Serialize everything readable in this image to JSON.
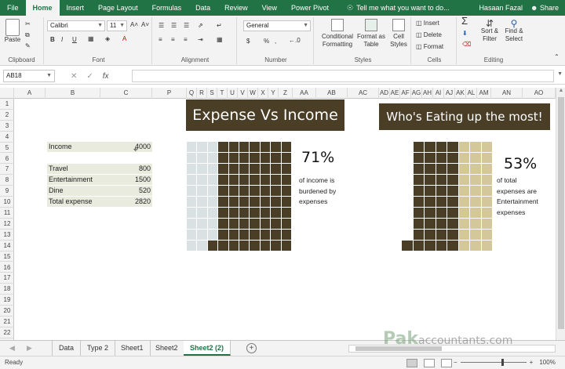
{
  "ribbon_tabs": [
    "File",
    "Home",
    "Insert",
    "Page Layout",
    "Formulas",
    "Data",
    "Review",
    "View",
    "Power Pivot"
  ],
  "active_tab": "Home",
  "tell_me": "Tell me what you want to do...",
  "user": "Hasaan Fazal",
  "share": "Share",
  "clipboard": {
    "paste": "Paste",
    "label": "Clipboard"
  },
  "font": {
    "name": "Calibri",
    "size": "11",
    "bold": "B",
    "italic": "I",
    "underline": "U",
    "label": "Font"
  },
  "alignment": {
    "label": "Alignment"
  },
  "number": {
    "format": "General",
    "currency": "$",
    "percent": "%",
    "comma": ",",
    "label": "Number"
  },
  "styles": {
    "conditional": "Conditional",
    "conditional2": "Formatting",
    "format_as": "Format as",
    "format_as2": "Table",
    "cell_styles": "Cell",
    "cell_styles2": "Styles",
    "label": "Styles"
  },
  "cells": {
    "insert": "Insert",
    "delete": "Delete",
    "format": "Format",
    "label": "Cells"
  },
  "editing": {
    "sum": "Σ",
    "sort": "Sort &",
    "sort2": "Filter",
    "find": "Find &",
    "find2": "Select",
    "label": "Editing"
  },
  "name_box": "AB18",
  "fx": "fx",
  "columns": [
    "A",
    "B",
    "C",
    "P",
    "Q",
    "R",
    "S",
    "T",
    "U",
    "V",
    "W",
    "X",
    "Y",
    "Z",
    "AA",
    "AB",
    "AC",
    "AD",
    "AE",
    "AF",
    "AG",
    "AH",
    "AI",
    "AJ",
    "AK",
    "AL",
    "AM",
    "AN",
    "AO"
  ],
  "rows": [
    "1",
    "2",
    "3",
    "4",
    "5",
    "6",
    "7",
    "8",
    "9",
    "10",
    "11",
    "12",
    "13",
    "14",
    "15",
    "16",
    "17",
    "18",
    "19",
    "20",
    "21",
    "22"
  ],
  "table": {
    "income_label": "Income",
    "income_value": "4000",
    "items": [
      {
        "label": "Travel",
        "value": "800"
      },
      {
        "label": "Entertainment",
        "value": "1500"
      },
      {
        "label": "Dine",
        "value": "520"
      },
      {
        "label": " Total expense",
        "value": "2820"
      }
    ]
  },
  "chart1": {
    "title": "Expense Vs Income",
    "percent": "71%",
    "desc": [
      "of income is",
      "burdened by",
      "expenses"
    ],
    "fill_fraction": 0.71,
    "color_fill": "#4a3e27",
    "color_empty": "#d9e1e3"
  },
  "chart2": {
    "title": "Who's Eating up the most!",
    "percent": "53%",
    "desc": [
      "of total",
      "expenses are",
      "Entertainment",
      "expenses"
    ],
    "dark_fraction": 0.47,
    "color_dark": "#4a3e27",
    "color_light": "#d4c79a"
  },
  "sheet_tabs": [
    "Data",
    "Type 2",
    "Sheet1",
    "Sheet2",
    "Sheet2 (2)"
  ],
  "active_sheet": "Sheet2 (2)",
  "status_ready": "Ready",
  "zoom": "100%",
  "watermark": {
    "a": "Pak",
    "b": "accountants.com"
  }
}
